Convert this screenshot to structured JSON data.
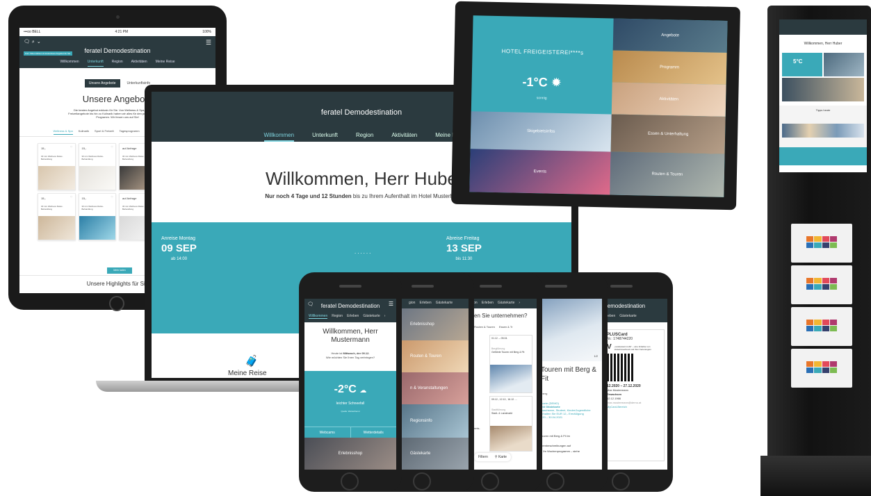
{
  "colors": {
    "brand_dark": "#2b3a3f",
    "accent": "#3aa9b8"
  },
  "tablet": {
    "status": {
      "carrier": "•••oo BELL",
      "time": "4:21 PM",
      "battery": "100%"
    },
    "title": "feratel Demodestination",
    "promo": "Zum Video klicken & kostenloses Angebot für Sie",
    "nav": [
      "Willkommen",
      "Unterkunft",
      "Region",
      "Aktivitäten",
      "Meine Reise"
    ],
    "tabs": [
      "Unsere Angebote",
      "Unterkunftsinfo"
    ],
    "heading": "Unsere Angebote",
    "intro": "Die besten Angebot exklusiv für Sie. Von Wellness & Spa, über Sport & Freizeitangebote bis hin zu Kulinarik haben wir alles für den perfekten Urlaub im Programm. Wir freuen uns auf Sie!",
    "categories": [
      "Wellness & Spa",
      "Kulinarik",
      "Sport & Freizeit",
      "Tagesprogramm",
      "Kinderprogramm",
      "Specials"
    ],
    "cards": [
      {
        "price": "15,-",
        "name": "30 min Wellness Relax-Behandlung"
      },
      {
        "price": "15,-",
        "name": "30 min Wellness Relax-Behandlung"
      },
      {
        "price": "auf Anfrage",
        "name": "30 min Wellness Relax-Behandlung"
      },
      {
        "price": "15,-/Std.",
        "name": "30 min Wellness Relax-Behandlung"
      },
      {
        "price": "15,-",
        "name": "30 min Wellness Relax-Behandlung"
      },
      {
        "price": "15,-",
        "name": "30 min Wellness Relax-Behandlung"
      },
      {
        "price": "auf Anfrage",
        "name": "30 min Wellness Relax-Behandlung"
      },
      {
        "price": "15,-/Std.",
        "name": "30 min Wellness Relax-Behandlung"
      }
    ],
    "more_button": "Mehr laden",
    "highlights": "Unsere Highlights für Sie"
  },
  "laptop": {
    "title": "feratel Demodestination",
    "nav": [
      "Willkommen",
      "Unterkunft",
      "Region",
      "Aktivitäten",
      "Meine Re"
    ],
    "heading": "Willkommen, Herr Hube",
    "subline_bold": "Nur noch 4 Tage und 12 Stunden",
    "subline_rest": " bis zu Ihrem Aufenthalt im Hotel Musterhof",
    "arrival": {
      "label": "Anreise Montag",
      "date": "09 SEP",
      "time": "ab 14:00"
    },
    "departure": {
      "label": "Abreise Freitag",
      "date": "13 SEP",
      "time": "bis 11:30"
    },
    "dots": "......",
    "my_trip": "Meine Reise"
  },
  "monitor": {
    "hotel": "HOTEL FREIGEISTEREI****s",
    "temperature": "-1°C",
    "condition": "sonnig",
    "tiles": [
      "Angebote",
      "Programm",
      "Aktivitäten",
      "Skigebietsinfos",
      "Essen & Unterhaltung",
      "Events",
      "Routen & Touren"
    ]
  },
  "kiosk": {
    "title": "Willkommen, Herr Huber",
    "temperature": "5°C",
    "tips": "Tipps heute"
  },
  "phones": {
    "p1": {
      "title": "feratel Demodestination",
      "nav": [
        "Willkommen",
        "Region",
        "Erleben",
        "Gästekarte"
      ],
      "welcome_line1": "Willkommen, Herr",
      "welcome_line2": "Mustermann",
      "today_prefix": "Heute ist ",
      "today_bold": "Mittwoch, der 09.12.",
      "today_q": "Wie möchten Sie Ihren Tag verbringen?",
      "temperature": "-2°C",
      "condition": "leichter Schneefall",
      "link": "Quelle: Wetterdienst",
      "btn_webcams": "Webcams",
      "btn_weather": "Wetterdetails",
      "bottom": "Erlebnisshop"
    },
    "p2": {
      "nav": [
        "gion",
        "Erleben",
        "Gästekarte"
      ],
      "items": [
        "Erlebnisshop",
        "Routen & Touren",
        "n & Veranstaltungen",
        "Regionsinfo",
        "Gästekarte"
      ]
    },
    "p3": {
      "nav": [
        "ion",
        "Erleben",
        "Gästekarte"
      ],
      "heading": "en Sie unternehmen?",
      "tabs": [
        "Routen & Touren",
        "Essen & Tr"
      ],
      "card1_date": "01.12. – 05.04.",
      "card1_cat": "Bergführung",
      "card1_title": "Geführte Touren mit Berg & Fit",
      "card2_date": "09.12., 12.12., 16.12. ...",
      "card2_cat": "Stadtführung",
      "card2_title": "Stadt- & Landmarkt",
      "card_prefix": "nnis-",
      "filter": "Filtern",
      "map": "Karte"
    },
    "p4": {
      "pager": "1/2",
      "heading": "Touren mit Berg & Fit",
      "cat": "rberg",
      "l1": "rkarte (DEMO)",
      "l2": "mit Gästekarte",
      "l3": "rwachsene, Student, Kinder/Jugendliche",
      "l4": "erhalten Sie EUR 12,- Ermäßigung",
      "l5": "020 – 30.04.2021",
      "body1": "touren mit Berg & Fit im",
      "body2": "urenbeschreibungen auf",
      "body3": "d Ihr Wochenprogramm – siehe"
    },
    "p5": {
      "title": "Demodestination",
      "nav": [
        "Erleben",
        "Gästekarte"
      ],
      "card": "PLUSCard",
      "number": "Nr.: 1748744220",
      "v": "V",
      "blurb": "„Landesweit mobil“ – eine Initiative von Verkehrsverbund und Ihrer Ferienregion",
      "validity": "12.2020 – 27.12.2020",
      "holder": "Max Mustermann",
      "type": "Erwachsen",
      "dob": "12.12.1966",
      "email": "max.mustermann@demo.at",
      "link": "MyCard-Bereich"
    }
  }
}
